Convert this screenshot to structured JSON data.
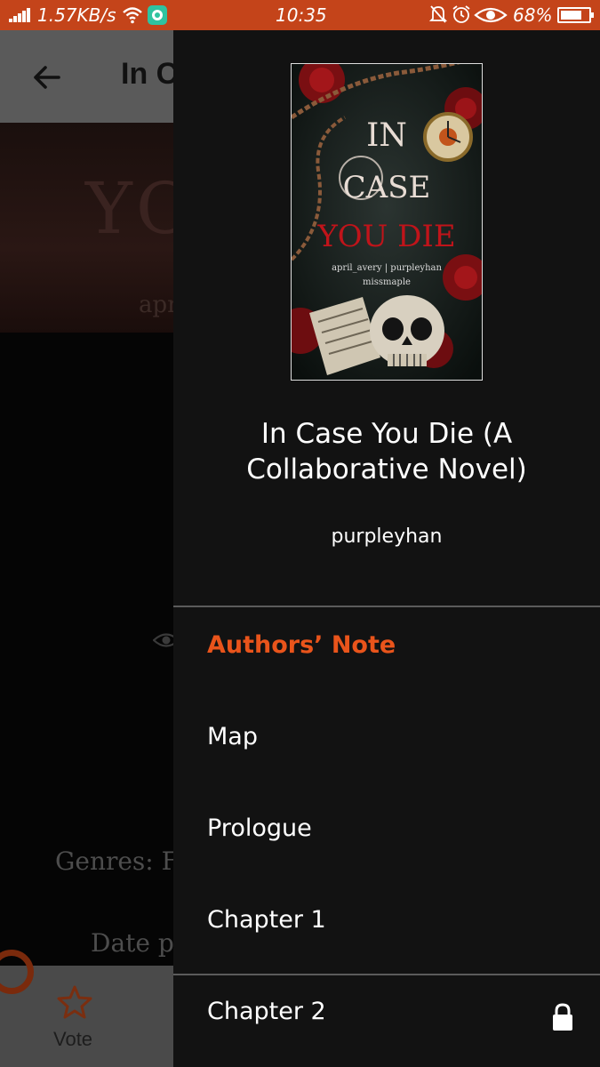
{
  "status_bar": {
    "network_speed": "1.57KB/s",
    "time": "10:35",
    "battery_percent": "68%",
    "battery_level": 0.68,
    "icons": [
      "signal-icon",
      "wifi-icon",
      "app-notification-icon",
      "bell-off-icon",
      "alarm-icon",
      "eye-comfort-icon",
      "battery-icon"
    ]
  },
  "background_page": {
    "title": "In C",
    "cover_text": "YO",
    "cover_sub": "apr",
    "genres": "Genres: F",
    "date": "Date p",
    "vote_label": "Vote"
  },
  "drawer": {
    "book_title": "In Case You Die (A Collaborative Novel)",
    "author": "purpleyhan",
    "cover": {
      "title_line1": "IN",
      "title_line2": "CASE",
      "title_line3": "YOU DIE",
      "authors_line": "april_avery | purpleyhan",
      "authors_line2": "missmaple"
    },
    "chapters": [
      {
        "label": "Authors’ Note",
        "active": true,
        "locked": false
      },
      {
        "label": "Map",
        "active": false,
        "locked": false
      },
      {
        "label": "Prologue",
        "active": false,
        "locked": false
      },
      {
        "label": "Chapter 1",
        "active": false,
        "locked": false
      },
      {
        "label": "Chapter 2",
        "active": false,
        "locked": true
      }
    ]
  },
  "colors": {
    "status_bar": "#c4441a",
    "accent": "#e9541b",
    "drawer_bg": "#121212"
  }
}
